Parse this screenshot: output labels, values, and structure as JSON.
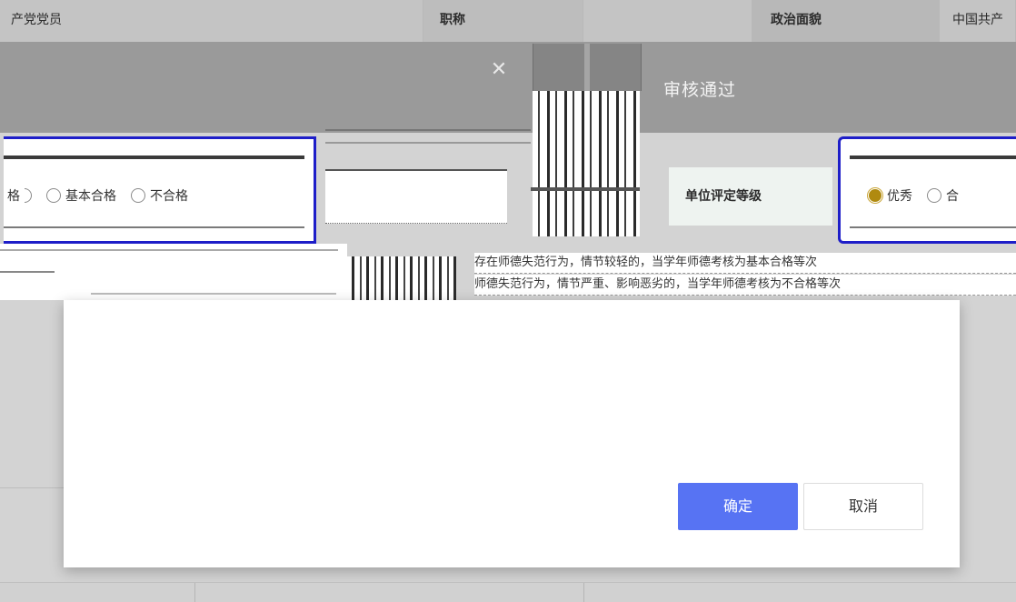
{
  "table_header": {
    "col1": "产党党员",
    "col2": "职称",
    "col3": "",
    "col4": "政治面貌",
    "col5": "中国共产"
  },
  "dialog": {
    "title": "审核通过",
    "close_icon": "close-icon"
  },
  "left_radio_group": {
    "options": [
      {
        "label": "格",
        "checked": false
      },
      {
        "label": "基本合格",
        "checked": false
      },
      {
        "label": "不合格",
        "checked": false
      }
    ]
  },
  "unit_rating": {
    "label": "单位评定等级",
    "options": [
      {
        "label": "优秀",
        "checked": true
      },
      {
        "label": "合",
        "checked": false
      }
    ]
  },
  "remarks": {
    "line1": "存在师德失范行为，情节较轻的，当学年师德考核为基本合格等次",
    "line2": "师德失范行为，情节严重、影响恶劣的，当学年师德考核为不合格等次"
  },
  "buttons": {
    "confirm": "确定",
    "cancel": "取消"
  },
  "colors": {
    "primary": "#5773f3",
    "focus_border": "#1e1ec8",
    "radio_checked": "#b08a10"
  }
}
